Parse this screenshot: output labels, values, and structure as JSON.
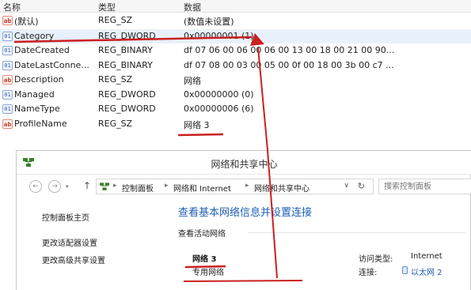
{
  "registry": {
    "columns": {
      "name": "名称",
      "type": "类型",
      "data": "数据"
    },
    "rows": [
      {
        "icon": "string-value-icon",
        "name": "(默认)",
        "type": "REG_SZ",
        "data": "(数值未设置)"
      },
      {
        "icon": "binary-value-icon",
        "name": "Category",
        "type": "REG_DWORD",
        "data": "0x00000001 (1)"
      },
      {
        "icon": "binary-value-icon",
        "name": "DateCreated",
        "type": "REG_BINARY",
        "data": "df 07 06 00 06 00 06 00 13 00 18 00 21 00 90..."
      },
      {
        "icon": "binary-value-icon",
        "name": "DateLastConne...",
        "type": "REG_BINARY",
        "data": "df 07 08 00 03 00 05 00 0f 00 18 00 3b 00 c7 ..."
      },
      {
        "icon": "string-value-icon",
        "name": "Description",
        "type": "REG_SZ",
        "data": "网络"
      },
      {
        "icon": "binary-value-icon",
        "name": "Managed",
        "type": "REG_DWORD",
        "data": "0x00000000 (0)"
      },
      {
        "icon": "binary-value-icon",
        "name": "NameType",
        "type": "REG_DWORD",
        "data": "0x00000006 (6)"
      },
      {
        "icon": "string-value-icon",
        "name": "ProfileName",
        "type": "REG_SZ",
        "data": "网络  3"
      }
    ]
  },
  "window": {
    "title": "网络和共享中心",
    "breadcrumbs": [
      "控制面板",
      "网络和 Internet",
      "网络和共享中心"
    ],
    "search_placeholder": "搜索控制面板",
    "sidebar": [
      "控制面板主页",
      "更改适配器设置",
      "更改高级共享设置"
    ],
    "main_title": "查看基本网络信息并设置连接",
    "section_label": "查看活动网络",
    "network_name": "网络  3",
    "network_type": "专用网络",
    "access_type_label": "访问类型:",
    "access_type_value": "Internet",
    "connection_label": "连接:",
    "connection_value": "以太网 2"
  },
  "colors": {
    "annotation": "#cc1f1f",
    "link": "#1e5fb4",
    "selection": "#e8f1fb"
  }
}
